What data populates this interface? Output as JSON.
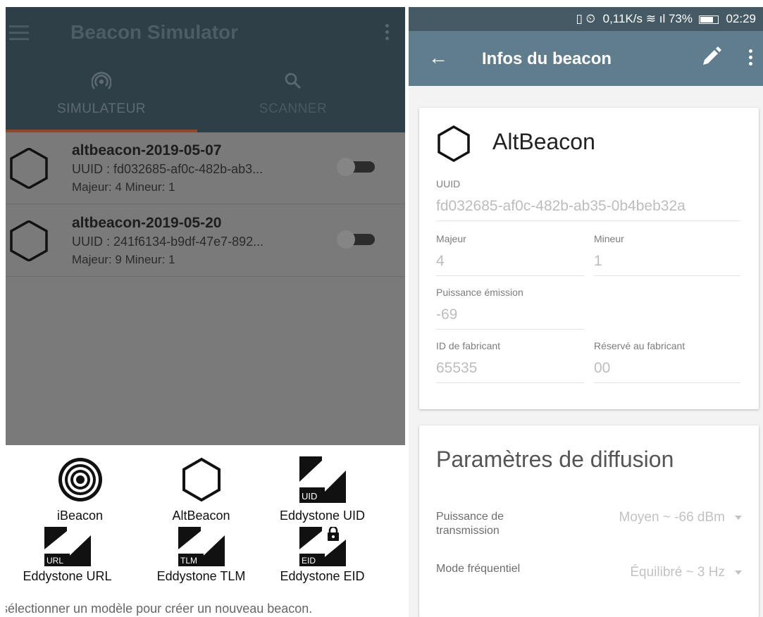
{
  "left": {
    "app_title": "Beacon Simulator",
    "tabs": [
      {
        "label": "SIMULATEUR",
        "icon": "broadcast-icon"
      },
      {
        "label": "SCANNER",
        "icon": "search-icon"
      }
    ],
    "beacons": [
      {
        "name": "altbeacon-2019-05-07",
        "uuid": "UUID : fd032685-af0c-482b-ab3...",
        "meta": "Majeur: 4 Mineur: 1",
        "enabled": false
      },
      {
        "name": "altbeacon-2019-05-20",
        "uuid": "UUID : 241f6134-b9df-47e7-892...",
        "meta": "Majeur: 9 Mineur: 1",
        "enabled": false
      }
    ],
    "templates": [
      {
        "label": "iBeacon",
        "icon": "ibeacon-icon"
      },
      {
        "label": "AltBeacon",
        "icon": "hexagon-icon"
      },
      {
        "label": "Eddystone UID",
        "icon": "eddystone-uid-icon",
        "badge": "UID"
      },
      {
        "label": "Eddystone URL",
        "icon": "eddystone-url-icon",
        "badge": "URL"
      },
      {
        "label": "Eddystone TLM",
        "icon": "eddystone-tlm-icon",
        "badge": "TLM"
      },
      {
        "label": "Eddystone EID",
        "icon": "eddystone-eid-icon",
        "badge": "EID"
      }
    ],
    "hint": "sélectionner un modèle pour créer un nouveau beacon."
  },
  "right": {
    "status": {
      "icons": "▯ ⏲",
      "speed": "0,11K/s",
      "signal": "≋ ıl",
      "battery": "73%",
      "time": "02:29"
    },
    "toolbar_title": "Infos du beacon",
    "card_title": "AltBeacon",
    "fields": {
      "uuid": {
        "label": "UUID",
        "value": "fd032685-af0c-482b-ab35-0b4beb32a"
      },
      "major": {
        "label": "Majeur",
        "value": "4"
      },
      "minor": {
        "label": "Mineur",
        "value": "1"
      },
      "tx_power": {
        "label": "Puissance émission",
        "value": "-69"
      },
      "manufacturer_id": {
        "label": "ID de fabricant",
        "value": "65535"
      },
      "manufacturer_reserved": {
        "label": "Réservé au fabricant",
        "value": "00"
      }
    },
    "broadcast": {
      "title": "Paramètres de diffusion",
      "tx_power": {
        "label": "Puissance de transmission",
        "value": "Moyen ~ -66 dBm"
      },
      "frequency": {
        "label": "Mode fréquentiel",
        "value": "Équilibré ~ 3 Hz"
      }
    }
  },
  "colors": {
    "appbar": "#2e3f47",
    "tab_indicator": "#8b4a2e",
    "dim_overlay": "#7a7a7a",
    "toolbar": "#5f7d8c",
    "statusbar": "#455a64"
  }
}
